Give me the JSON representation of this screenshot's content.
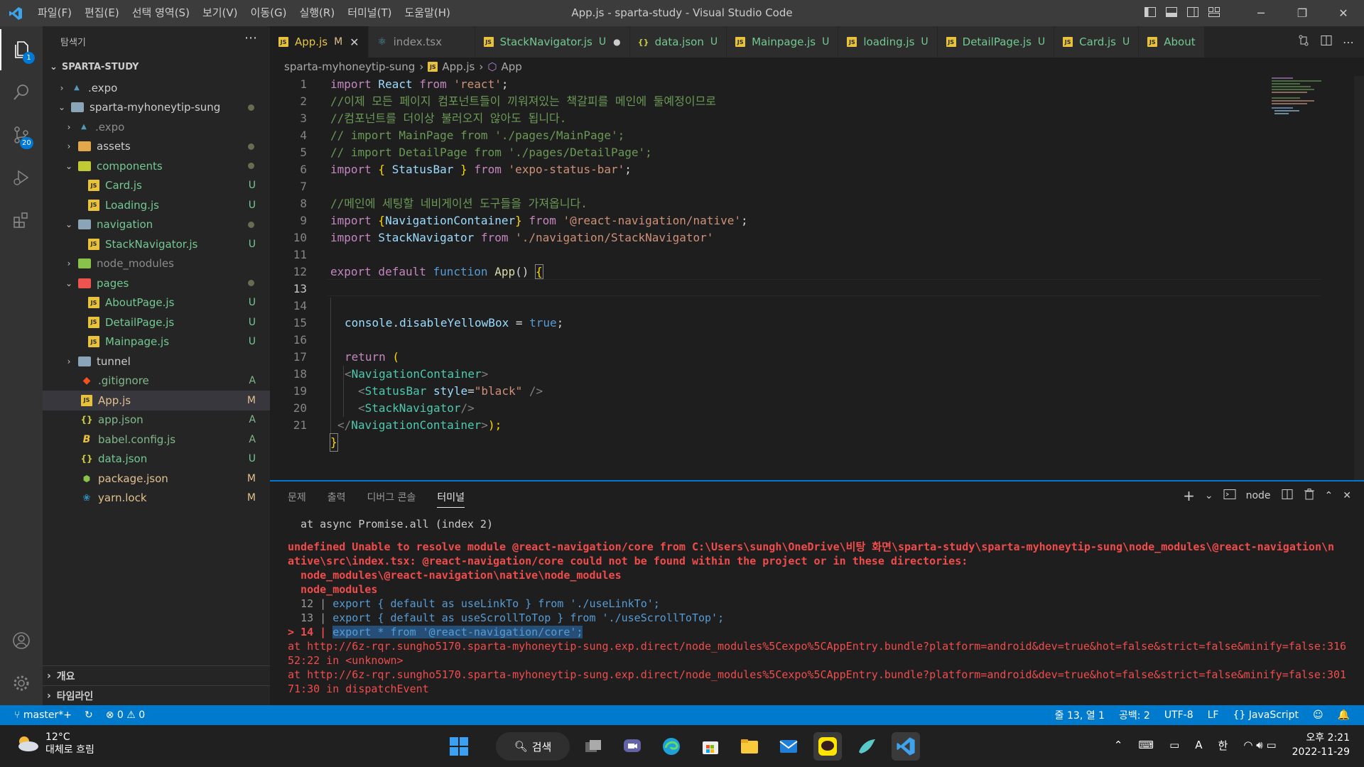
{
  "titlebar": {
    "menus": [
      "파일(F)",
      "편집(E)",
      "선택 영역(S)",
      "보기(V)",
      "이동(G)",
      "실행(R)",
      "터미널(T)",
      "도움말(H)"
    ],
    "title": "App.js - sparta-study - Visual Studio Code"
  },
  "activity": {
    "explorer_badge": "1",
    "scm_badge": "20"
  },
  "sidebar": {
    "title": "탐색기",
    "root": "SPARTA-STUDY",
    "items": [
      {
        "label": ".expo",
        "status": ""
      },
      {
        "label": "sparta-myhoneytip-sung",
        "status": ""
      },
      {
        "label": ".expo",
        "status": ""
      },
      {
        "label": "assets",
        "status": ""
      },
      {
        "label": "components",
        "status": ""
      },
      {
        "label": "Card.js",
        "status": "U"
      },
      {
        "label": "Loading.js",
        "status": "U"
      },
      {
        "label": "navigation",
        "status": ""
      },
      {
        "label": "StackNavigator.js",
        "status": "U"
      },
      {
        "label": "node_modules",
        "status": ""
      },
      {
        "label": "pages",
        "status": ""
      },
      {
        "label": "AboutPage.js",
        "status": "U"
      },
      {
        "label": "DetailPage.js",
        "status": "U"
      },
      {
        "label": "Mainpage.js",
        "status": "U"
      },
      {
        "label": "tunnel",
        "status": ""
      },
      {
        "label": ".gitignore",
        "status": "A"
      },
      {
        "label": "App.js",
        "status": "M"
      },
      {
        "label": "app.json",
        "status": "A"
      },
      {
        "label": "babel.config.js",
        "status": "A"
      },
      {
        "label": "data.json",
        "status": "U"
      },
      {
        "label": "package.json",
        "status": "M"
      },
      {
        "label": "yarn.lock",
        "status": "M"
      }
    ],
    "outline": "개요",
    "timeline": "타임라인"
  },
  "tabs": [
    {
      "label": "App.js",
      "mark": "M"
    },
    {
      "label": "index.tsx",
      "mark": ""
    },
    {
      "label": "StackNavigator.js",
      "mark": "U"
    },
    {
      "label": "data.json",
      "mark": "U"
    },
    {
      "label": "Mainpage.js",
      "mark": "U"
    },
    {
      "label": "loading.js",
      "mark": "U"
    },
    {
      "label": "DetailPage.js",
      "mark": "U"
    },
    {
      "label": "Card.js",
      "mark": "U"
    },
    {
      "label": "About",
      "mark": ""
    }
  ],
  "breadcrumb": {
    "folder": "sparta-myhoneytip-sung",
    "file": "App.js",
    "symbol": "App"
  },
  "editor": {
    "line_numbers": [
      "1",
      "2",
      "3",
      "4",
      "5",
      "6",
      "7",
      "8",
      "9",
      "10",
      "11",
      "12",
      "13",
      "14",
      "15",
      "16",
      "17",
      "18",
      "19",
      "20",
      "21"
    ],
    "current_line": 13,
    "code": {
      "l1": {
        "a": "import",
        "b": " React ",
        "c": "from",
        "d": " 'react'",
        "e": ";"
      },
      "l2": "//이제 모든 페이지 컴포넌트들이 끼워져있는 책갈피를 메인에 둘예정이므로",
      "l3": "//컴포넌트를 더이상 불러오지 않아도 됩니다.",
      "l4": "// import MainPage from './pages/MainPage';",
      "l5": "// import DetailPage from './pages/DetailPage';",
      "l6": {
        "a": "import",
        "b": " { ",
        "c": "StatusBar",
        "d": " } ",
        "e": "from",
        "f": " 'expo-status-bar'",
        "g": ";"
      },
      "l8": "//메인에 세팅할 네비게이션 도구들을 가져옵니다.",
      "l9": {
        "a": "import",
        "b": " {",
        "c": "NavigationContainer",
        "d": "} ",
        "e": "from",
        "f": " '@react-navigation/native'",
        "g": ";"
      },
      "l10": {
        "a": "import",
        "b": " StackNavigator ",
        "c": "from",
        "d": " './navigation/StackNavigator'"
      },
      "l12": {
        "a": "export",
        "b": " default ",
        "c": "function",
        "d": " App",
        "e": "() ",
        "f": "{"
      },
      "l14": {
        "a": "console",
        "b": ".",
        "c": "disableYellowBox",
        "d": " = ",
        "e": "true",
        "f": ";"
      },
      "l16": {
        "a": "return",
        "b": " ("
      },
      "l17": {
        "a": "<",
        "b": "NavigationContainer",
        "c": ">"
      },
      "l18": {
        "a": "<",
        "b": "StatusBar",
        "c": " style",
        "d": "=",
        "e": "\"black\"",
        "f": " />"
      },
      "l19": {
        "a": "<",
        "b": "StackNavigator",
        "c": "/>"
      },
      "l20": {
        "a": "</",
        "b": "NavigationContainer",
        "c": ">",
        "d": ");"
      },
      "l21": "}"
    }
  },
  "panel": {
    "tabs": [
      "문제",
      "출력",
      "디버그 콘솔",
      "터미널"
    ],
    "active_tab": "터미널",
    "shell": "node",
    "terminal": {
      "l1": "  at async Promise.all (index 2)",
      "l2": "undefined Unable to resolve module @react-navigation/core from C:\\Users\\sungh\\OneDrive\\비탕 화면\\sparta-study\\sparta-myhoneytip-sung\\node_modules\\@react-navigation\\n",
      "l3": "ative\\src\\index.tsx: @react-navigation/core could not be found within the project or in these directories:",
      "l4": "  node_modules\\@react-navigation\\native\\node_modules",
      "l5": "  node_modules",
      "l6a": "  12 | ",
      "l6b": "export { default as useLinkTo } from './useLinkTo';",
      "l7a": "  13 | ",
      "l7b": "export { default as useScrollToTop } from './useScrollToTop';",
      "l8a": "> 14 | ",
      "l8b": "export * from '@react-navigation/core';",
      "l9": "at http://6z-rqr.sungho5170.sparta-myhoneytip-sung.exp.direct/node_modules%5Cexpo%5CAppEntry.bundle?platform=android&dev=true&hot=false&strict=false&minify=false:316",
      "l10": "52:22 in <unknown>",
      "l11": "at http://6z-rqr.sungho5170.sparta-myhoneytip-sung.exp.direct/node_modules%5Cexpo%5CAppEntry.bundle?platform=android&dev=true&hot=false&strict=false&minify=false:301",
      "l12": "71:30 in dispatchEvent"
    }
  },
  "statusbar": {
    "branch": "master*+",
    "errors": "0",
    "warnings": "0",
    "position": "줄 13, 열 1",
    "spaces": "공백: 2",
    "encoding": "UTF-8",
    "eol": "LF",
    "language": "JavaScript"
  },
  "taskbar": {
    "temperature": "12°C",
    "weather": "대체로 흐림",
    "search": "검색",
    "time": "오후 2:21",
    "date": "2022-11-29",
    "ime": "한",
    "font_icon": "A"
  },
  "colors": {
    "accent": "#007acc",
    "error": "#f14c4c",
    "modified": "#e2c08d",
    "untracked": "#73c991"
  }
}
